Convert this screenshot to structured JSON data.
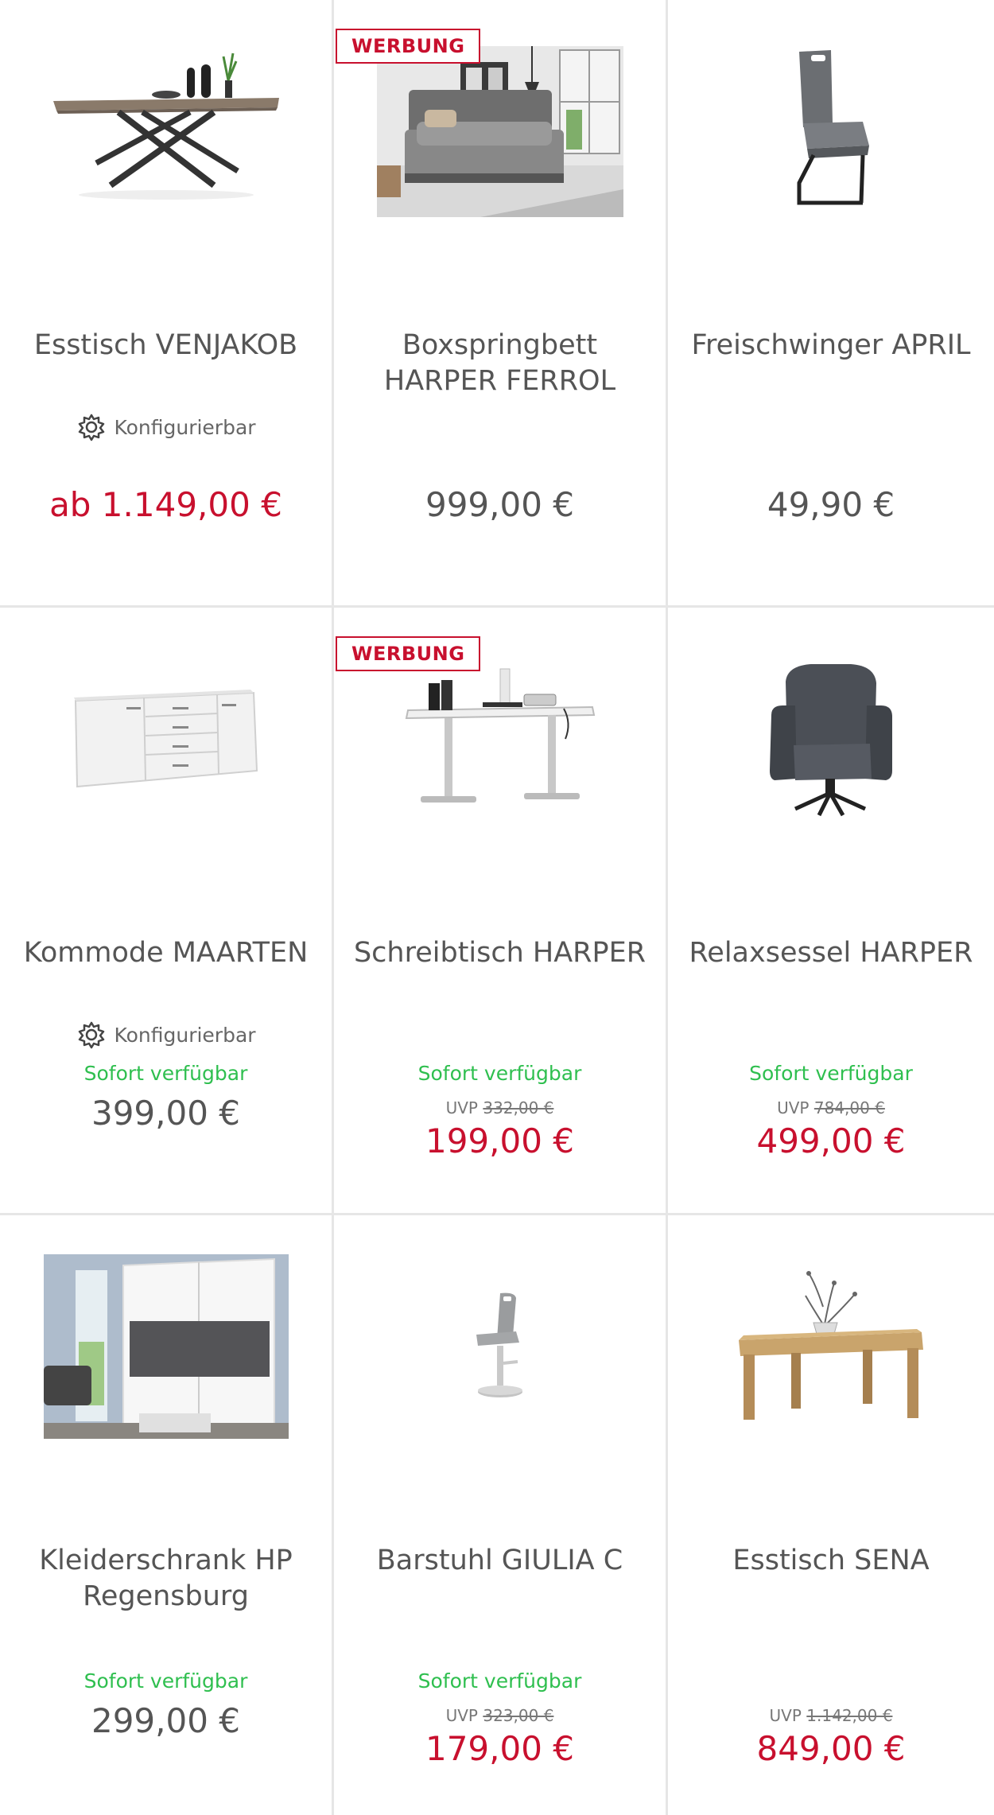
{
  "products": [
    {
      "title": "Esstisch VENJAKOB",
      "badge": "",
      "config_label": "Konfigurierbar",
      "availability": "",
      "uvp_label": "",
      "uvp_price": "",
      "price": "ab 1.149,00 €",
      "price_color": "#c8102e",
      "image_icon": "dining-table-icon"
    },
    {
      "title": "Boxspringbett HARPER FERROL",
      "badge": "WERBUNG",
      "config_label": "",
      "availability": "",
      "uvp_label": "",
      "uvp_price": "",
      "price": "999,00 €",
      "price_color": "#555555",
      "image_icon": "bedroom-photo-icon"
    },
    {
      "title": "Freischwinger APRIL",
      "badge": "",
      "config_label": "",
      "availability": "",
      "uvp_label": "",
      "uvp_price": "",
      "price": "49,90 €",
      "price_color": "#555555",
      "image_icon": "cantilever-chair-icon"
    },
    {
      "title": "Kommode MAARTEN",
      "badge": "",
      "config_label": "Konfigurierbar",
      "availability": "Sofort verfügbar",
      "uvp_label": "",
      "uvp_price": "",
      "price": "399,00 €",
      "price_color": "#555555",
      "image_icon": "sideboard-icon"
    },
    {
      "title": "Schreibtisch HARPER",
      "badge": "WERBUNG",
      "config_label": "",
      "availability": "Sofort verfügbar",
      "uvp_label": "UVP",
      "uvp_price": "332,00 €",
      "price": "199,00 €",
      "price_color": "#c8102e",
      "image_icon": "standing-desk-icon"
    },
    {
      "title": "Relaxsessel HARPER",
      "badge": "",
      "config_label": "",
      "availability": "Sofort verfügbar",
      "uvp_label": "UVP",
      "uvp_price": "784,00 €",
      "price": "499,00 €",
      "price_color": "#c8102e",
      "image_icon": "recliner-icon"
    },
    {
      "title": "Kleiderschrank HP Regensburg",
      "badge": "",
      "config_label": "",
      "availability": "Sofort verfügbar",
      "uvp_label": "",
      "uvp_price": "",
      "price": "299,00 €",
      "price_color": "#555555",
      "image_icon": "wardrobe-photo-icon"
    },
    {
      "title": "Barstuhl GIULIA C",
      "badge": "",
      "config_label": "",
      "availability": "Sofort verfügbar",
      "uvp_label": "UVP",
      "uvp_price": "323,00 €",
      "price": "179,00 €",
      "price_color": "#c8102e",
      "image_icon": "bar-stool-icon"
    },
    {
      "title": "Esstisch SENA",
      "badge": "",
      "config_label": "",
      "availability": "",
      "uvp_label": "UVP",
      "uvp_price": "1.142,00 €",
      "price": "849,00 €",
      "price_color": "#c8102e",
      "image_icon": "wooden-table-icon"
    }
  ]
}
